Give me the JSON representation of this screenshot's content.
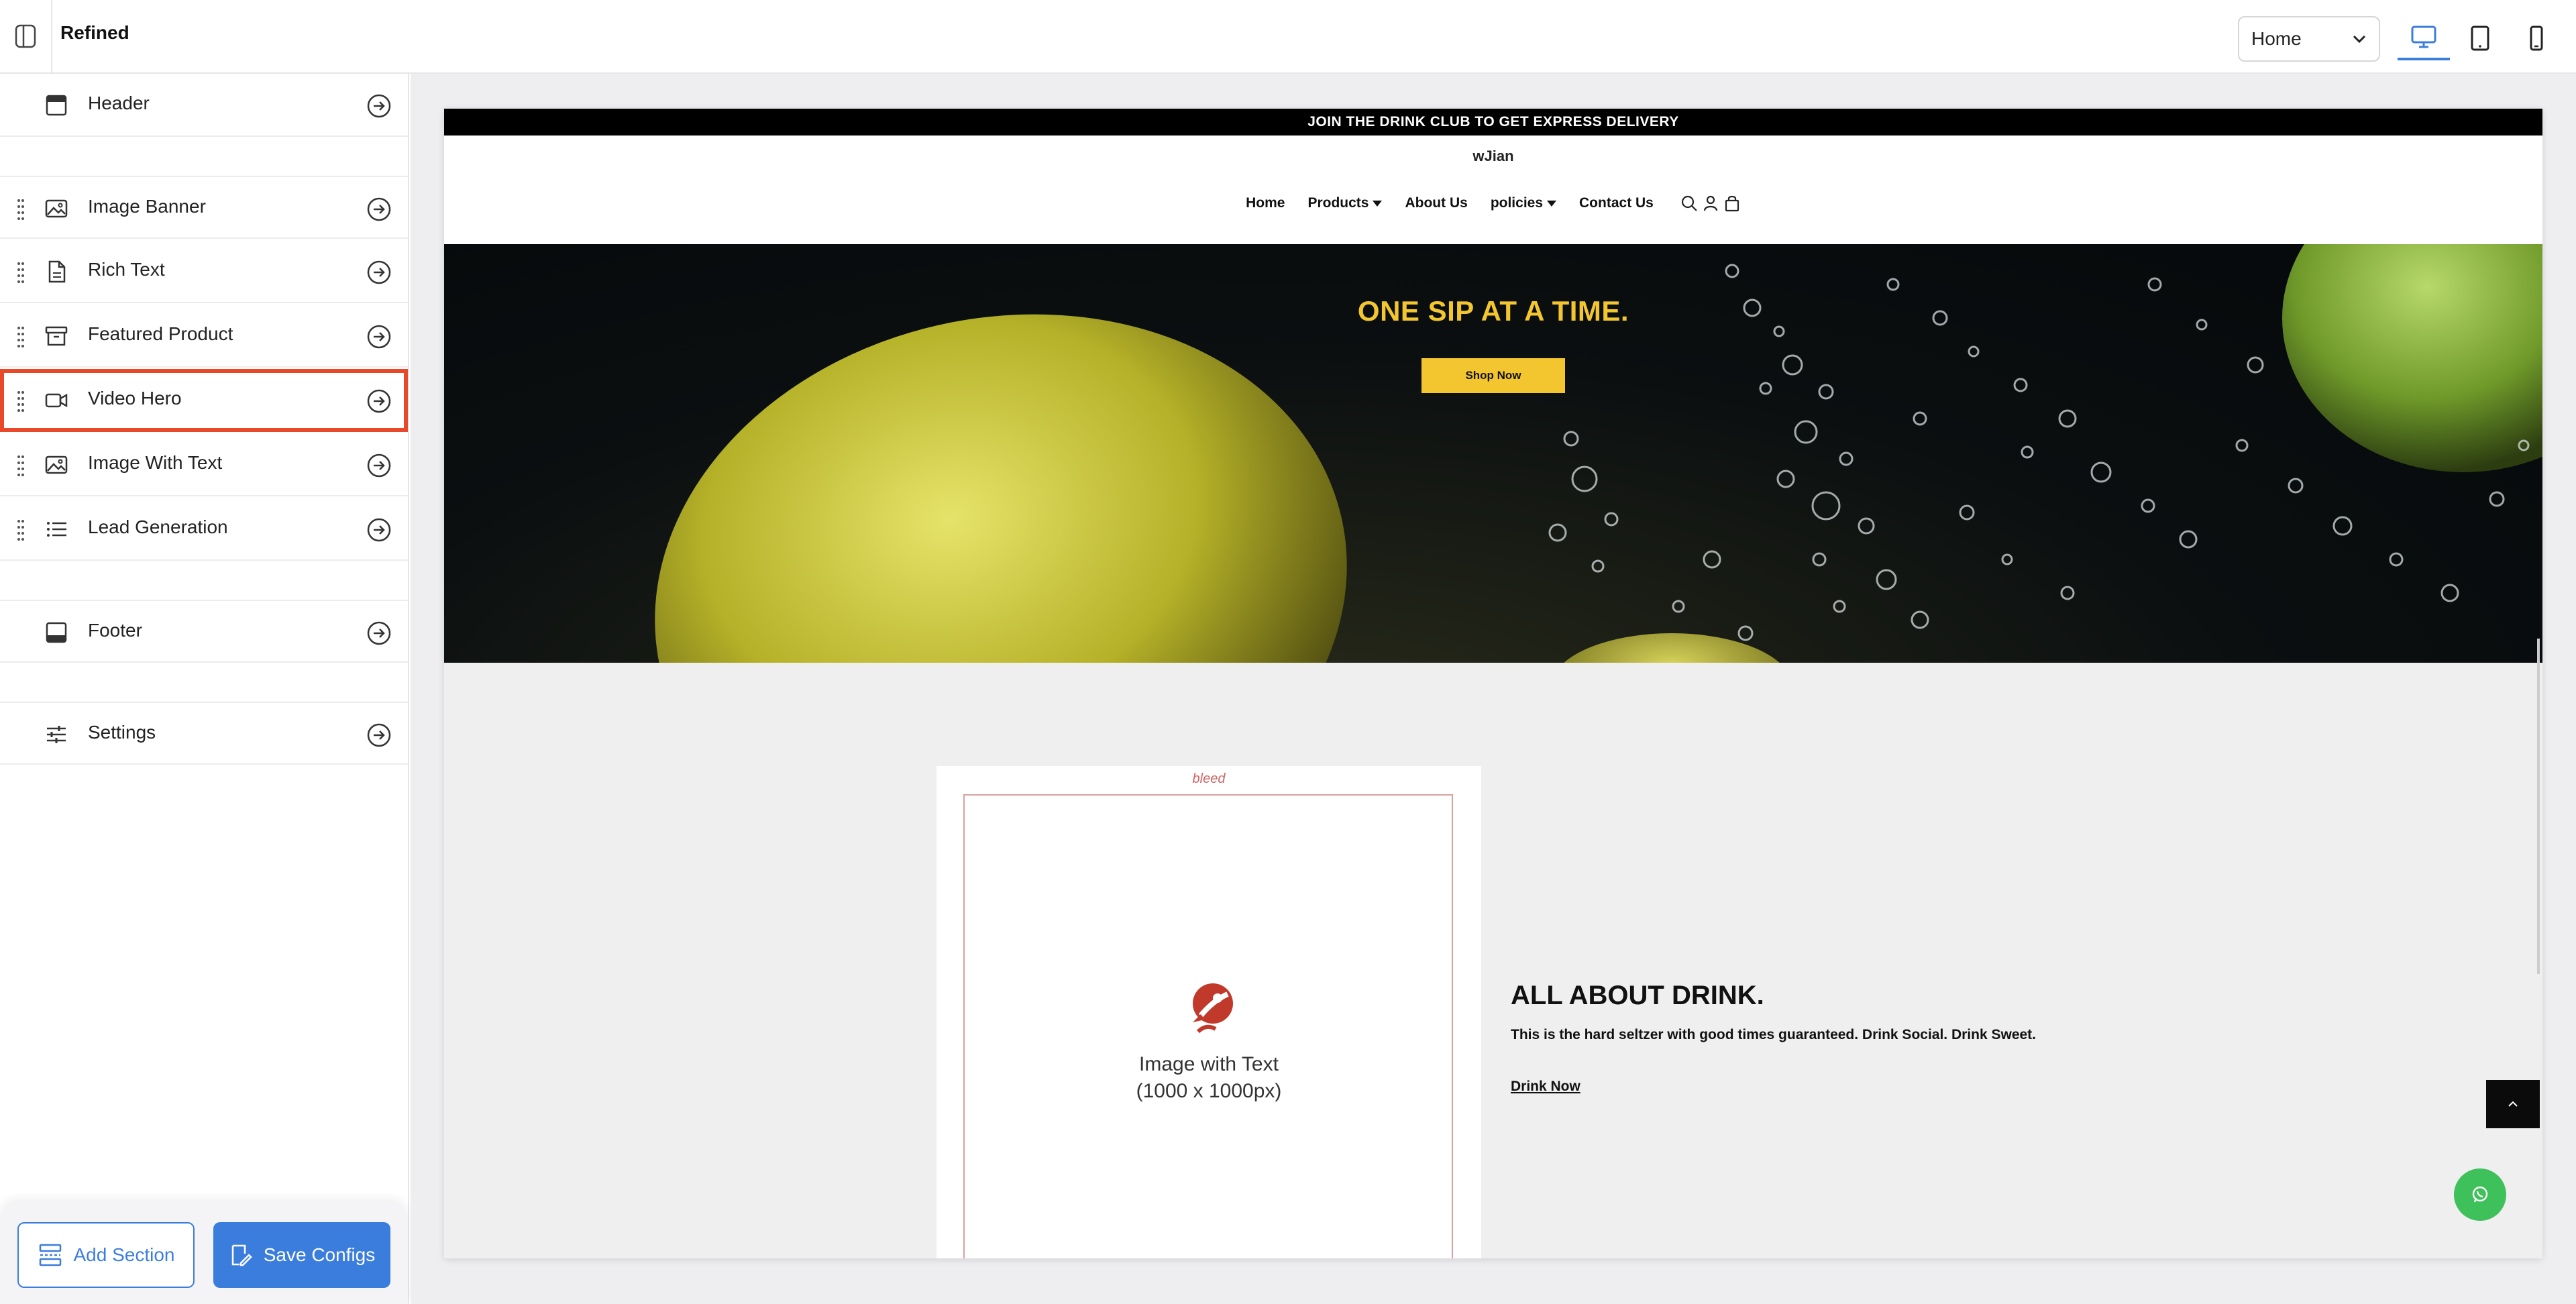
{
  "topbar": {
    "title": "Refined",
    "page_select": {
      "value": "Home"
    },
    "devices": [
      "desktop-icon",
      "tablet-icon",
      "mobile-icon"
    ],
    "active_device": "desktop"
  },
  "sidebar": {
    "sections": [
      {
        "label": "Header",
        "icon": "header-icon",
        "draggable": false
      },
      {
        "label": "Image Banner",
        "icon": "image-icon",
        "draggable": true
      },
      {
        "label": "Rich Text",
        "icon": "document-icon",
        "draggable": true
      },
      {
        "label": "Featured Product",
        "icon": "archive-icon",
        "draggable": true
      },
      {
        "label": "Video Hero",
        "icon": "video-icon",
        "draggable": true,
        "selected": true
      },
      {
        "label": "Image With Text",
        "icon": "image-icon",
        "draggable": true
      },
      {
        "label": "Lead Generation",
        "icon": "list-icon",
        "draggable": true
      },
      {
        "label": "Footer",
        "icon": "footer-icon",
        "draggable": false
      },
      {
        "label": "Settings",
        "icon": "sliders-icon",
        "draggable": false
      }
    ],
    "add_section_label": "Add Section",
    "save_configs_label": "Save Configs"
  },
  "preview": {
    "announcement": "JOIN THE DRINK CLUB TO GET EXPRESS DELIVERY",
    "logo": "wJian",
    "nav": [
      {
        "label": "Home",
        "dropdown": false
      },
      {
        "label": "Products",
        "dropdown": true
      },
      {
        "label": "About Us",
        "dropdown": false
      },
      {
        "label": "policies",
        "dropdown": true
      },
      {
        "label": "Contact Us",
        "dropdown": false
      }
    ],
    "hero": {
      "title": "ONE SIP AT A TIME.",
      "button": "Shop Now"
    },
    "image_with_text": {
      "bleed": "bleed",
      "caption_line1": "Image with Text",
      "caption_line2": "(1000 x 1000px)",
      "title": "ALL ABOUT DRINK.",
      "body": "This is the hard seltzer with good times guaranteed. Drink Social. Drink Sweet.",
      "link": "Drink Now"
    }
  },
  "colors": {
    "accent": "#3b7ddd",
    "selected_outline": "#e8492a",
    "hero_yellow": "#f3c62f",
    "whatsapp_green": "#3ec05a"
  }
}
